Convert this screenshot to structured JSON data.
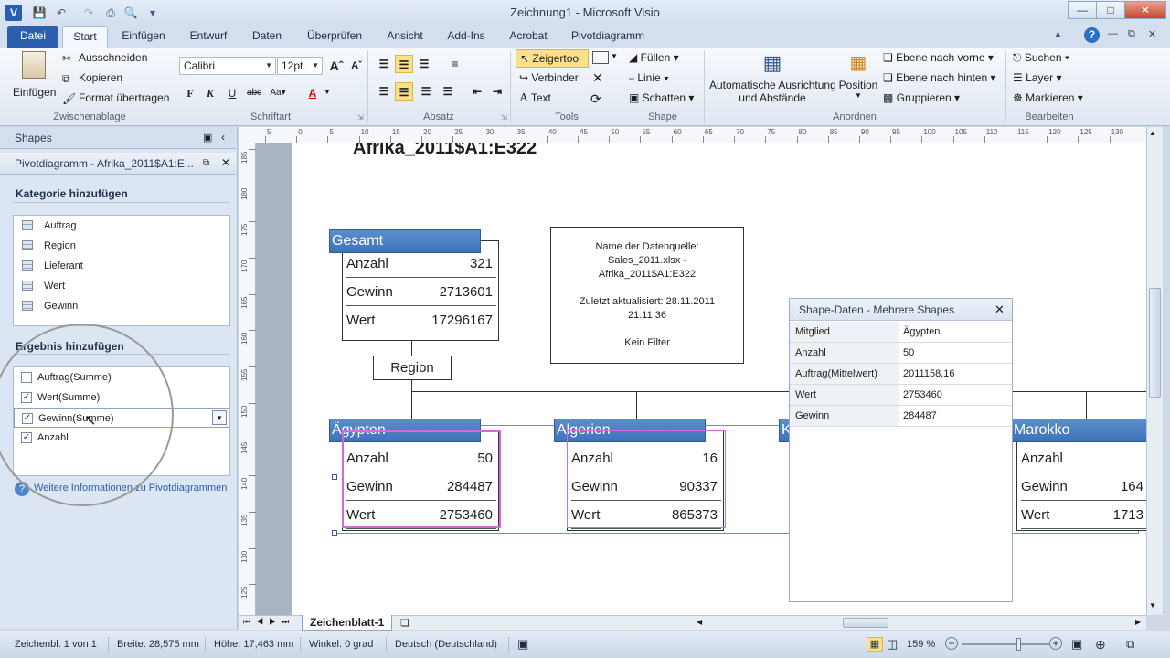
{
  "window": {
    "title": "Zeichnung1 - Microsoft Visio"
  },
  "qat": {
    "icons": [
      "visio-app-icon",
      "save-icon",
      "undo-icon",
      "redo-icon",
      "print-icon",
      "print-preview-icon",
      "customize-qat-icon"
    ]
  },
  "tabs": [
    {
      "label": "Datei"
    },
    {
      "label": "Start"
    },
    {
      "label": "Einfügen"
    },
    {
      "label": "Entwurf"
    },
    {
      "label": "Daten"
    },
    {
      "label": "Überprüfen"
    },
    {
      "label": "Ansicht"
    },
    {
      "label": "Add-Ins"
    },
    {
      "label": "Acrobat"
    },
    {
      "label": "Pivotdiagramm"
    }
  ],
  "ribbon": {
    "clipboard": {
      "paste": "Einfügen",
      "cut": "Ausschneiden",
      "copy": "Kopieren",
      "format_painter": "Format übertragen",
      "label": "Zwischenablage"
    },
    "font": {
      "name": "Calibri",
      "size": "12pt.",
      "label": "Schriftart"
    },
    "paragraph": {
      "label": "Absatz"
    },
    "tools": {
      "pointer": "Zeigertool",
      "connector": "Verbinder",
      "text": "Text",
      "label": "Tools"
    },
    "shape": {
      "fill": "Füllen",
      "line": "Linie",
      "shadow": "Schatten",
      "label": "Shape"
    },
    "arrange": {
      "auto_align": "Automatische Ausrichtung",
      "auto_align2": "und Abstände",
      "position": "Position",
      "bring_front": "Ebene nach vorne",
      "send_back": "Ebene nach hinten",
      "group": "Gruppieren",
      "label": "Anordnen"
    },
    "editing": {
      "find": "Suchen",
      "layer": "Layer",
      "select": "Markieren",
      "label": "Bearbeiten"
    }
  },
  "shapes_pane": {
    "title": "Shapes",
    "pivot_title": "Pivotdiagramm - Afrika_2011$A1:E...",
    "add_category": "Kategorie hinzufügen",
    "categories": [
      {
        "label": "Auftrag"
      },
      {
        "label": "Region"
      },
      {
        "label": "Lieferant"
      },
      {
        "label": "Wert"
      },
      {
        "label": "Gewinn"
      }
    ],
    "add_result": "Ergebnis hinzufügen",
    "results": [
      {
        "label": "Auftrag(Summe)",
        "checked": false
      },
      {
        "label": "Wert(Summe)",
        "checked": true
      },
      {
        "label": "Gewinn(Summe)",
        "checked": true
      },
      {
        "label": "Anzahl",
        "checked": true
      }
    ],
    "help_link": "Weitere Informationen zu Pivotdiagrammen"
  },
  "drawing": {
    "heading": "Afrika_2011$A1:E322",
    "total": {
      "title": "Gesamt",
      "rows": [
        {
          "label": "Anzahl",
          "value": "321"
        },
        {
          "label": "Gewinn",
          "value": "2713601"
        },
        {
          "label": "Wert",
          "value": "17296167"
        }
      ]
    },
    "info": {
      "l1": "Name der Datenquelle:",
      "l2": "Sales_2011.xlsx -",
      "l3": "Afrika_2011$A1:E322",
      "l4": "Zuletzt aktualisiert: 28.11.2011",
      "l5": "21:11:36",
      "l6": "Kein Filter"
    },
    "region_label": "Region",
    "nodes": [
      {
        "title": "Ägypten",
        "rows": [
          {
            "label": "Anzahl",
            "value": "50"
          },
          {
            "label": "Gewinn",
            "value": "284487"
          },
          {
            "label": "Wert",
            "value": "2753460"
          }
        ]
      },
      {
        "title": "Algerien",
        "rows": [
          {
            "label": "Anzahl",
            "value": "16"
          },
          {
            "label": "Gewinn",
            "value": "90337"
          },
          {
            "label": "Wert",
            "value": "865373"
          }
        ]
      },
      {
        "title": "K",
        "rows": []
      },
      {
        "title": "Marokko",
        "rows": [
          {
            "label": "Anzahl",
            "value": ""
          },
          {
            "label": "Gewinn",
            "value": "164"
          },
          {
            "label": "Wert",
            "value": "1713"
          }
        ]
      }
    ]
  },
  "shape_data": {
    "title": "Shape-Daten - Mehrere Shapes",
    "rows": [
      {
        "key": "Mitglied",
        "value": "Ägypten"
      },
      {
        "key": "Anzahl",
        "value": "50"
      },
      {
        "key": "Auftrag(Mittelwert)",
        "value": "2011158,16"
      },
      {
        "key": "Wert",
        "value": "2753460"
      },
      {
        "key": "Gewinn",
        "value": "284487"
      }
    ]
  },
  "sheet_tab": "Zeichenblatt-1",
  "status": {
    "page": "Zeichenbl. 1 von 1",
    "width": "Breite: 28,575 mm",
    "height": "Höhe: 17,463 mm",
    "angle": "Winkel: 0 grad",
    "language": "Deutsch (Deutschland)",
    "zoom": "159 %"
  },
  "rulers": {
    "top": [
      "5",
      "0",
      "5",
      "10",
      "15",
      "20",
      "25",
      "30",
      "35",
      "40",
      "45",
      "50",
      "55",
      "60",
      "65",
      "70",
      "75",
      "80",
      "85",
      "90",
      "95",
      "100",
      "105",
      "110",
      "115",
      "120",
      "125",
      "130",
      "135"
    ],
    "left": [
      "185",
      "180",
      "175",
      "170",
      "165",
      "160",
      "155",
      "150",
      "145",
      "140",
      "135",
      "130",
      "125"
    ]
  },
  "colors": {
    "accent": "#2a5fb0",
    "node_header": "#4a7fc4",
    "selection": "#d36bd3"
  }
}
